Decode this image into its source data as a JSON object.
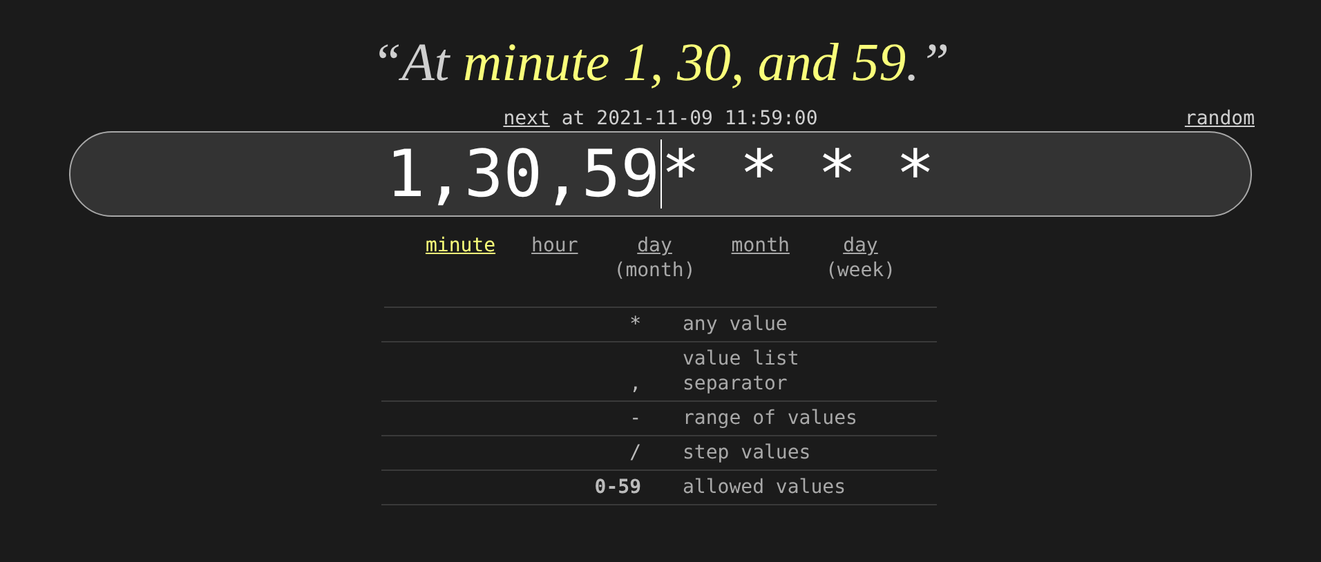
{
  "description": [
    {
      "text": "“At ",
      "highlighted": false
    },
    {
      "text": "minute 1, 30, and 59",
      "highlighted": true
    },
    {
      "text": ".”",
      "highlighted": false
    }
  ],
  "next": {
    "link": "next",
    "text": "at 2021-11-09 11:59:00"
  },
  "random": "random",
  "expression": [
    "1,30,59",
    "*",
    "*",
    "*",
    "*"
  ],
  "fields": [
    {
      "label": "minute",
      "selected": true
    },
    {
      "label": "hour",
      "selected": false
    },
    {
      "label": "day",
      "sub": "(month)",
      "selected": false
    },
    {
      "label": "month",
      "selected": false
    },
    {
      "label": "day",
      "sub": "(week)",
      "selected": false
    }
  ],
  "legend": [
    {
      "symbol": "*",
      "meaning": "any value",
      "bold": false
    },
    {
      "symbol": ",",
      "meaning": "value list separator",
      "bold": false
    },
    {
      "symbol": "-",
      "meaning": "range of values",
      "bold": false
    },
    {
      "symbol": "/",
      "meaning": "step values",
      "bold": false
    },
    {
      "symbol": "0-59",
      "meaning": "allowed values",
      "bold": true
    }
  ]
}
